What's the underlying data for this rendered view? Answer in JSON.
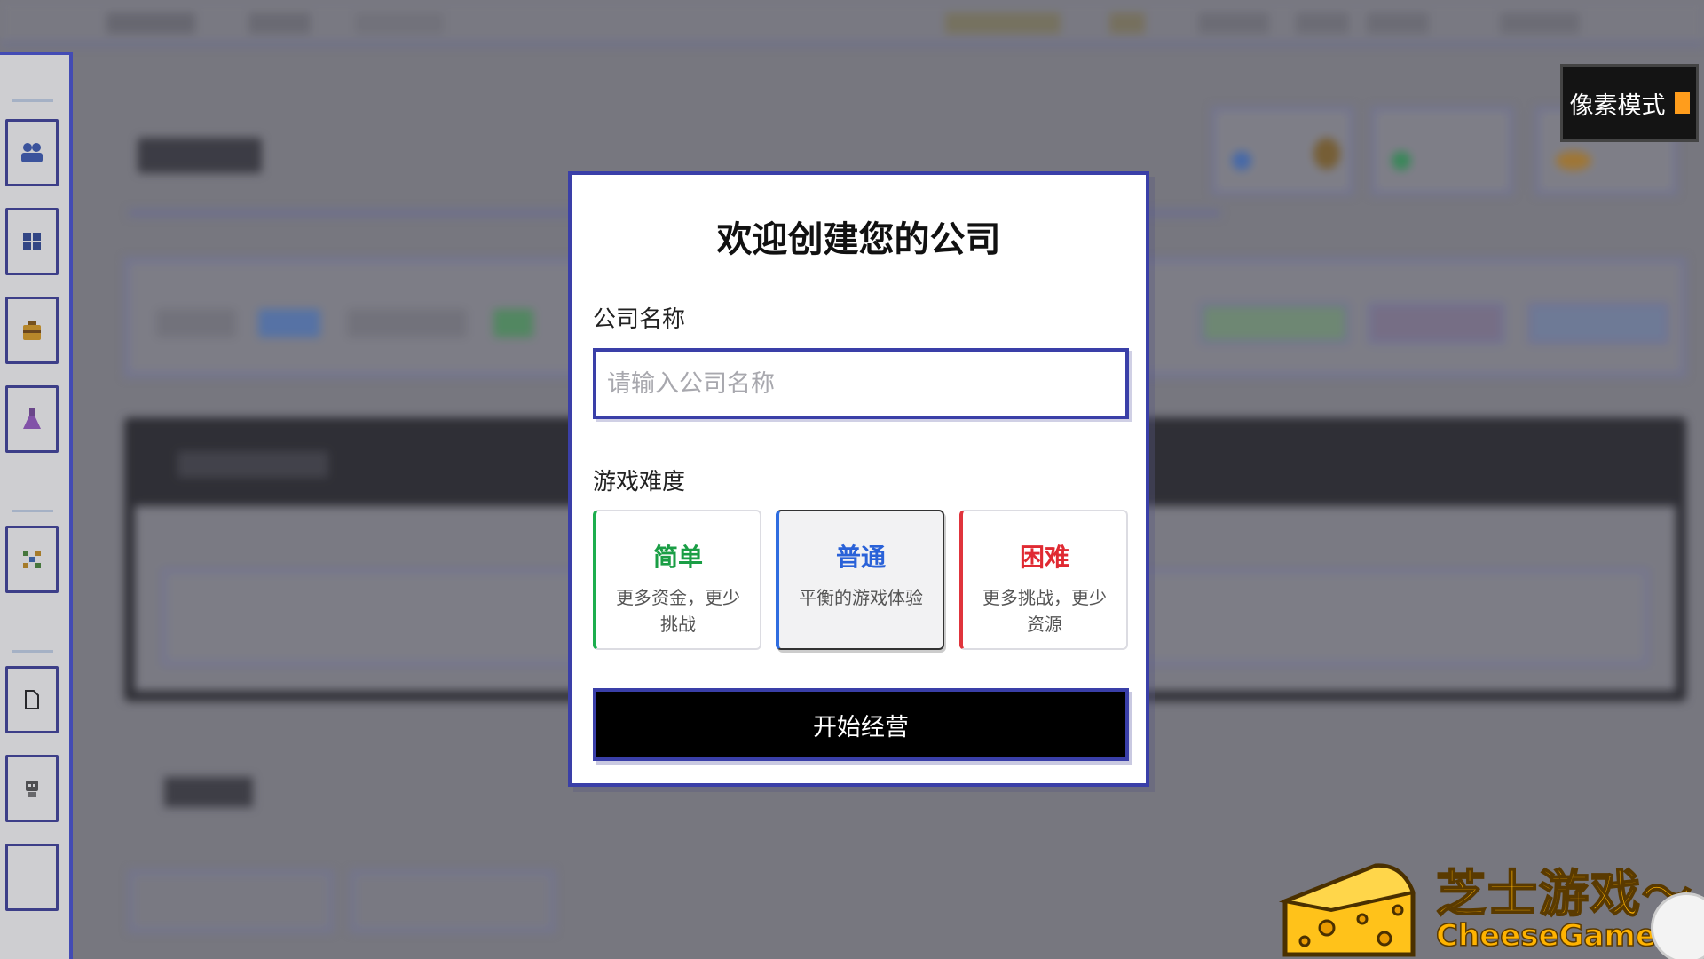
{
  "modal": {
    "title": "欢迎创建您的公司",
    "company_name_label": "公司名称",
    "company_name_placeholder": "请输入公司名称",
    "company_name_value": "",
    "difficulty_label": "游戏难度",
    "difficulties": [
      {
        "name": "简单",
        "desc": "更多资金，更少挑战",
        "accent": "#1cae4e",
        "selected": false
      },
      {
        "name": "普通",
        "desc": "平衡的游戏体验",
        "accent": "#2f6de0",
        "selected": true
      },
      {
        "name": "困难",
        "desc": "更多挑战，更少资源",
        "accent": "#e0343c",
        "selected": false
      }
    ],
    "start_button": "开始经营"
  },
  "pixel_mode": {
    "label": "像素模式",
    "toggle_color": "#ff9d1c"
  },
  "sidebar": {
    "icons": [
      "team-icon",
      "grid-icon",
      "briefcase-icon",
      "flask-icon",
      "network-icon",
      "file-icon",
      "robot-icon",
      "empty-slot"
    ]
  },
  "watermark": {
    "cn": "芝士游戏～",
    "en": "CheeseGame.org"
  },
  "colors": {
    "accent": "#3a3fa8",
    "sidebar_border": "#4650d8"
  }
}
